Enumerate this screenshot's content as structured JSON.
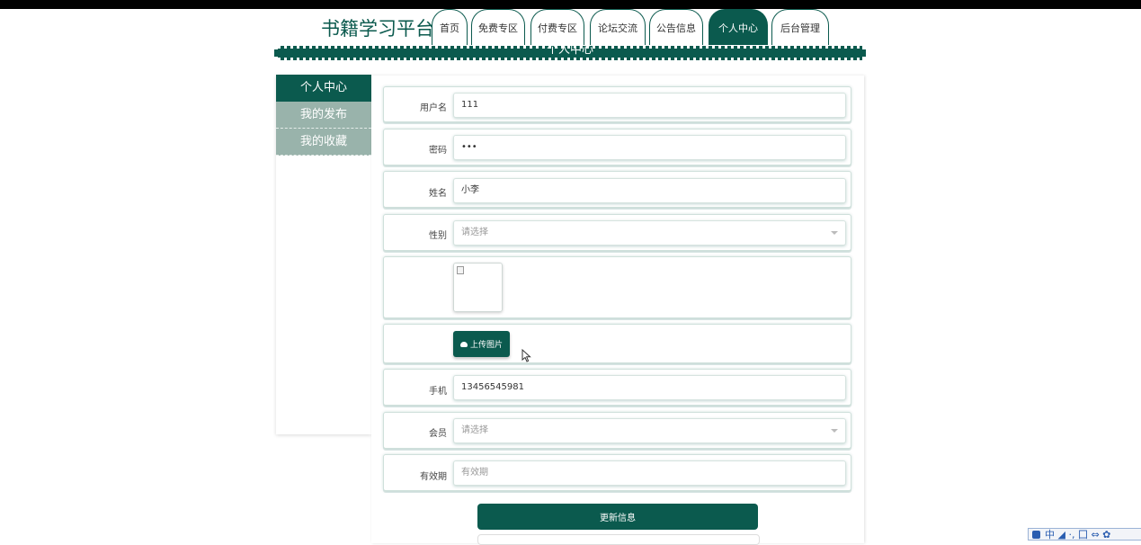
{
  "app": {
    "title": "书籍学习平台"
  },
  "nav": {
    "tabs": [
      {
        "label": "首页",
        "active": false
      },
      {
        "label": "免费专区",
        "active": false
      },
      {
        "label": "付费专区",
        "active": false
      },
      {
        "label": "论坛交流",
        "active": false
      },
      {
        "label": "公告信息",
        "active": false
      },
      {
        "label": "个人中心",
        "active": true
      },
      {
        "label": "后台管理",
        "active": false
      }
    ]
  },
  "page": {
    "banner_title": "个人中心"
  },
  "sidebar": {
    "items": [
      {
        "label": "个人中心",
        "active": true
      },
      {
        "label": "我的发布",
        "active": false
      },
      {
        "label": "我的收藏",
        "active": false
      }
    ]
  },
  "form": {
    "username": {
      "label": "用户名",
      "value": "111"
    },
    "password": {
      "label": "密码",
      "value": "•••"
    },
    "name": {
      "label": "姓名",
      "value": "小李"
    },
    "gender": {
      "label": "性别",
      "value": "请选择"
    },
    "upload_label": "上传图片",
    "phone": {
      "label": "手机",
      "value": "13456545981"
    },
    "member": {
      "label": "会员",
      "value": "请选择"
    },
    "validity": {
      "label": "有效期",
      "placeholder": "有效期"
    },
    "submit_label": "更新信息"
  },
  "ime": {
    "text": "中 ◢ ·, 囗 ⇔ ✿"
  },
  "colors": {
    "primary": "#0b5a4e",
    "sidebar_inactive": "#99b3ab"
  }
}
